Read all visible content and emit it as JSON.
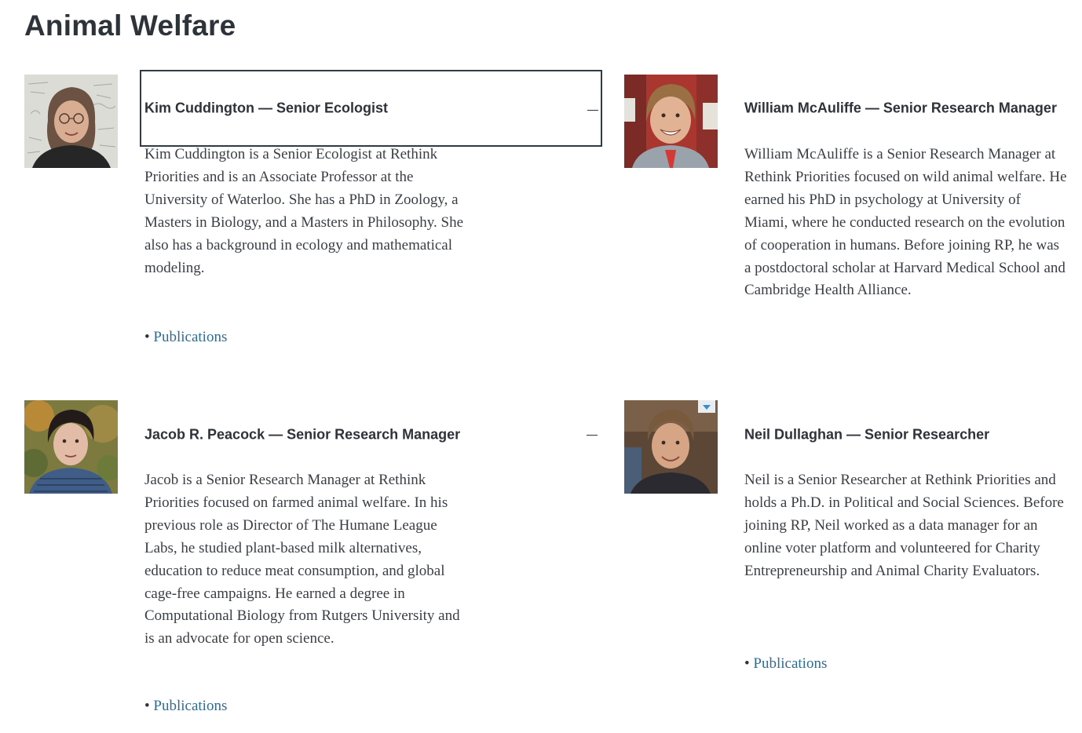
{
  "section": {
    "title": "Animal Welfare"
  },
  "members": [
    {
      "name": "Kim Cuddington — Senior Ecologist",
      "bio": "Kim Cuddington is a Senior Ecologist at Rethink Priorities and is an Associate Professor at the University of Waterloo. She has a PhD in Zoology, a Masters in Biology, and a Masters in Philosophy. She also has a background in ecology and mathematical modeling.",
      "bullet": "•",
      "publications_label": "Publications",
      "toggle_icon": "minus-icon"
    },
    {
      "name": "William McAuliffe — Senior Research Manager",
      "bio": "William McAuliffe is a Senior Research Manager at Rethink Priorities focused on wild animal welfare. He earned his PhD in psychology at University of Miami, where he conducted research on the evolution of cooperation in humans. Before joining RP, he was a postdoctoral scholar at Harvard Medical School and Cambridge Health Alliance."
    },
    {
      "name": "Jacob R. Peacock — Senior Research Manager",
      "bio": "Jacob is a Senior Research Manager at Rethink Priorities focused on farmed animal welfare. In his previous role as Director of The Humane League Labs, he studied plant-based milk alternatives, education to reduce meat consumption, and global cage-free campaigns. He earned a degree in Computational Biology from Rutgers University and is an advocate for open science.",
      "bullet": "•",
      "publications_label": "Publications",
      "toggle_icon": "minus-icon"
    },
    {
      "name": "Neil Dullaghan — Senior Researcher",
      "bio": "Neil is a Senior Researcher at Rethink Priorities and holds a Ph.D. in Political and Social Sciences. Before joining RP, Neil worked as a data manager for an online voter platform and volunteered for Charity Entrepreneurship and Animal Charity Evaluators.",
      "bullet": "•",
      "publications_label": "Publications"
    }
  ],
  "colors": {
    "heading": "#2d3339",
    "body_text": "#3a3f44",
    "link": "#2f6c8f",
    "focus_border": "#2f3a42"
  }
}
